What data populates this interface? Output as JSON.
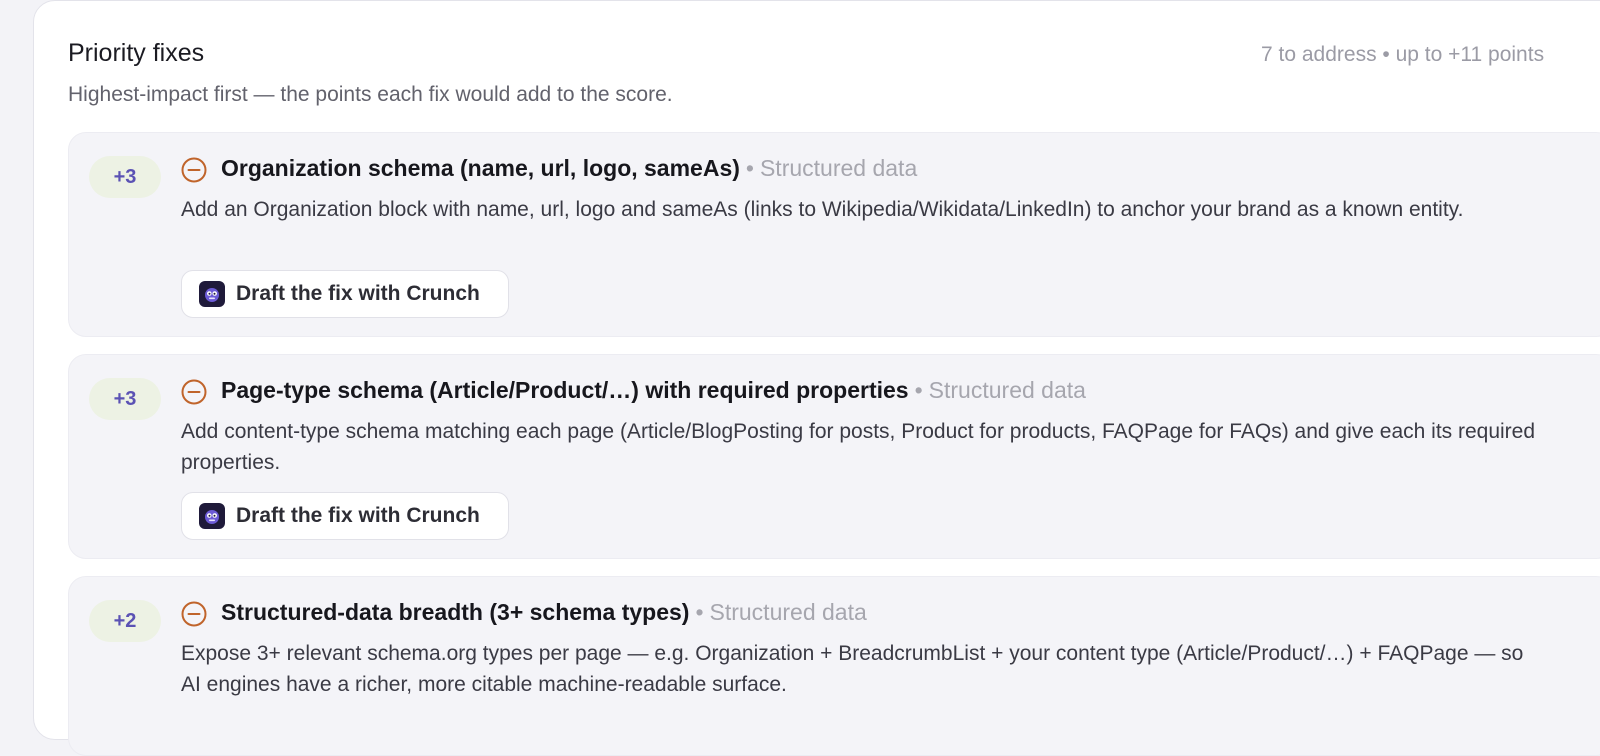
{
  "panel": {
    "title": "Priority fixes",
    "meta": "7 to address • up to +11 points",
    "subtitle": "Highest-impact first — the points each fix would add to the score."
  },
  "fixes": [
    {
      "points": "+3",
      "title": "Organization schema (name, url, logo, sameAs)",
      "separator": "•",
      "category": "Structured data",
      "description": "Add an Organization block with name, url, logo and sameAs (links to Wikipedia/Wikidata/LinkedIn) to anchor your brand as a known entity.",
      "action_label": "Draft the fix with Crunch",
      "status_icon": "minus-circle-icon"
    },
    {
      "points": "+3",
      "title": "Page-type schema (Article/Product/…) with required properties",
      "separator": "•",
      "category": "Structured data",
      "description": "Add content-type schema matching each page (Article/BlogPosting for posts, Product for products, FAQPage for FAQs) and give each its required properties.",
      "action_label": "Draft the fix with Crunch",
      "status_icon": "minus-circle-icon"
    },
    {
      "points": "+2",
      "title": "Structured-data breadth (3+ schema types)",
      "separator": "•",
      "category": "Structured data",
      "description": "Expose 3+ relevant schema.org types per page — e.g. Organization + BreadcrumbList + your content type (Article/Product/…) + FAQPage — so AI engines have a richer, more citable machine-readable surface.",
      "status_icon": "minus-circle-icon"
    }
  ],
  "colors": {
    "accent_points": "#5b52b4",
    "points_badge_bg": "#edf2e4",
    "status_icon": "#c0642b",
    "item_bg": "#f4f4f8"
  }
}
